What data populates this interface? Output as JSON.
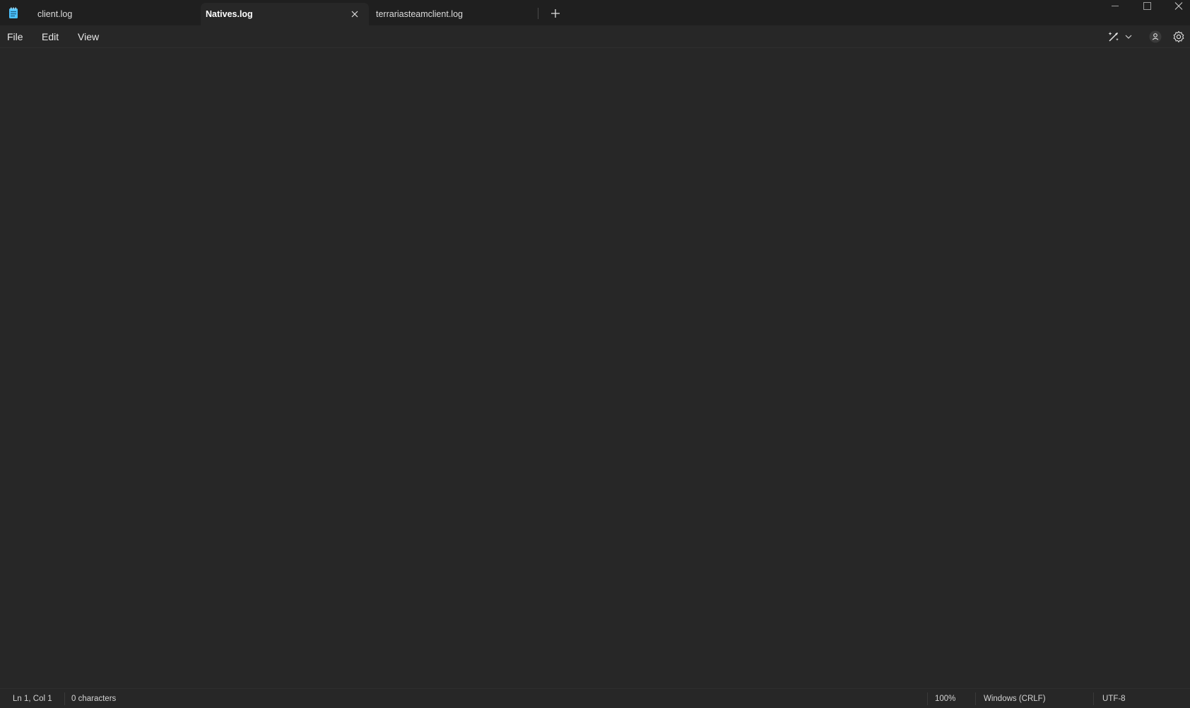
{
  "app": {
    "icon": "notepad-icon",
    "accent_color": "#4cc2ff"
  },
  "tabs": [
    {
      "label": "client.log",
      "active": false
    },
    {
      "label": "Natives.log",
      "active": true
    },
    {
      "label": "terrariasteamclient.log",
      "active": false
    }
  ],
  "tab_bar": {
    "close_icon": "close-icon",
    "new_tab_icon": "plus-icon"
  },
  "window_controls": [
    "minimize-icon",
    "maximize-icon",
    "close-icon"
  ],
  "menu": {
    "file": "File",
    "edit": "Edit",
    "view": "View"
  },
  "toolbar": {
    "icons": [
      "copilot-rewrite-icon",
      "chevron-down-icon",
      "account-icon",
      "settings-icon"
    ]
  },
  "editor": {
    "content": ""
  },
  "status": {
    "position": "Ln 1, Col 1",
    "characters": "0 characters",
    "zoom": "100%",
    "line_ending": "Windows (CRLF)",
    "encoding": "UTF-8"
  }
}
